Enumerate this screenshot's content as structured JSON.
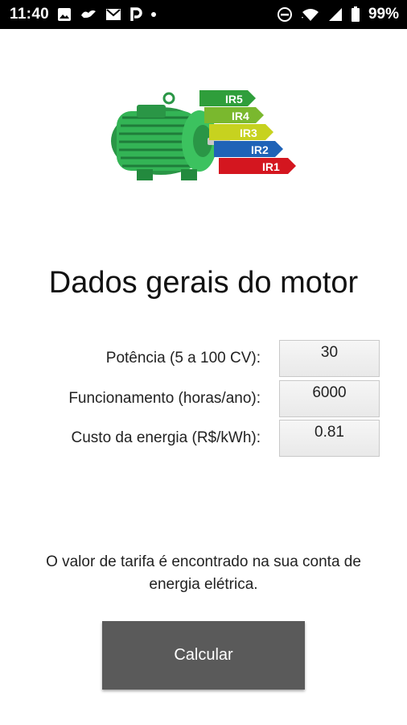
{
  "status_bar": {
    "time": "11:40",
    "battery_percent": "99%",
    "icons_left": [
      "image-icon",
      "bird-app-icon",
      "gmail-icon",
      "p-app-icon",
      "dot-icon"
    ],
    "icons_right": [
      "do-not-disturb-icon",
      "wifi-icon",
      "signal-icon",
      "battery-icon"
    ]
  },
  "hero": {
    "motor_color": "#2fa84f",
    "efficiency_labels": [
      "IR5",
      "IR4",
      "IR3",
      "IR2",
      "IR1"
    ],
    "efficiency_colors": [
      "#2f9e3b",
      "#7ab82e",
      "#c7d21f",
      "#1f63b7",
      "#d4161f"
    ]
  },
  "page": {
    "title": "Dados gerais do motor"
  },
  "form": {
    "power_label": "Potência (5 a 100 CV):",
    "power_value": "30",
    "hours_label": "Funcionamento (horas/ano):",
    "hours_value": "6000",
    "cost_label": "Custo da energia (R$/kWh):",
    "cost_value": "0.81"
  },
  "note": {
    "text": "O valor de tarifa é encontrado na sua conta de energia elétrica."
  },
  "actions": {
    "calculate_label": "Calcular",
    "button_color": "#5a5a5a"
  }
}
